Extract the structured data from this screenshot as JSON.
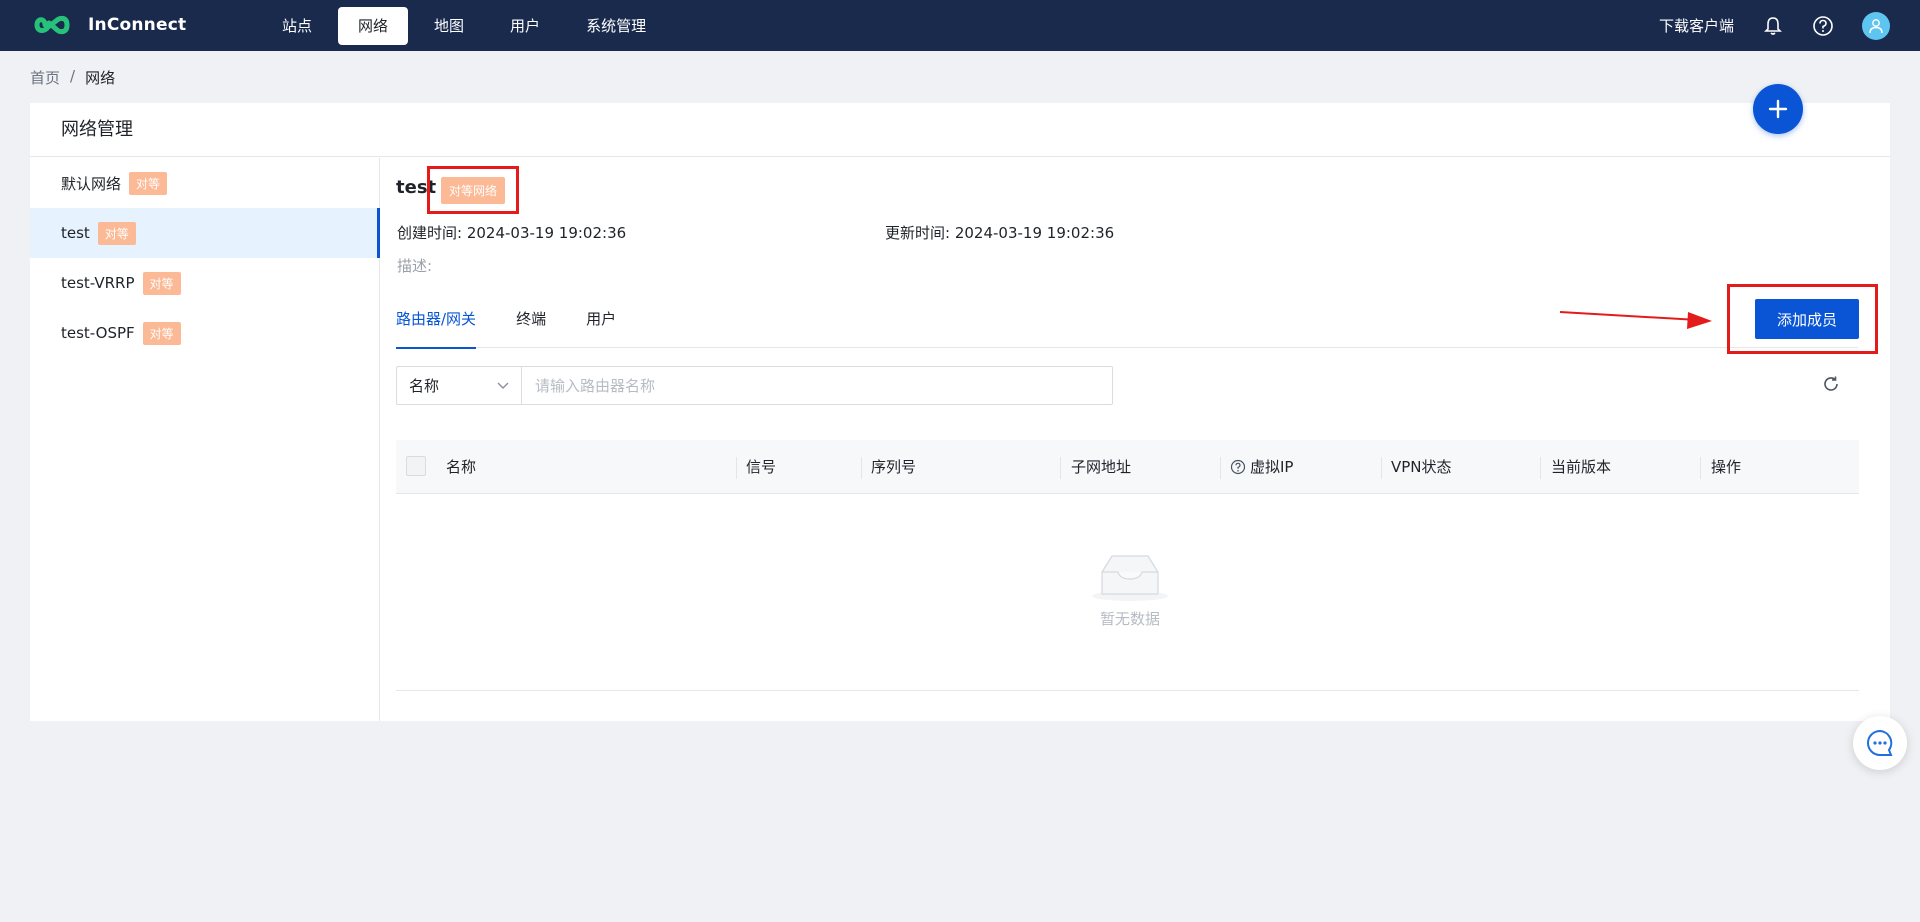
{
  "app": {
    "name": "InConnect"
  },
  "nav": {
    "items": [
      {
        "label": "站点",
        "active": false
      },
      {
        "label": "网络",
        "active": true
      },
      {
        "label": "地图",
        "active": false
      },
      {
        "label": "用户",
        "active": false
      },
      {
        "label": "系统管理",
        "active": false
      }
    ],
    "download": "下载客户端"
  },
  "breadcrumb": {
    "home": "首页",
    "separator": "/",
    "current": "网络"
  },
  "panel": {
    "title": "网络管理"
  },
  "sidebar": {
    "items": [
      {
        "name": "默认网络",
        "tag": "对等",
        "active": false
      },
      {
        "name": "test",
        "tag": "对等",
        "active": true
      },
      {
        "name": "test-VRRP",
        "tag": "对等",
        "active": false
      },
      {
        "name": "test-OSPF",
        "tag": "对等",
        "active": false
      }
    ]
  },
  "detail": {
    "name": "test",
    "type_tag": "对等网络",
    "created_label": "创建时间:",
    "created_value": "2024-03-19 19:02:36",
    "updated_label": "更新时间:",
    "updated_value": "2024-03-19 19:02:36",
    "desc_label": "描述:"
  },
  "tabs": [
    {
      "label": "路由器/网关",
      "active": true
    },
    {
      "label": "终端",
      "active": false
    },
    {
      "label": "用户",
      "active": false
    }
  ],
  "add_member": "添加成员",
  "filter": {
    "field": "名称",
    "placeholder": "请输入路由器名称"
  },
  "table": {
    "columns": [
      "名称",
      "信号",
      "序列号",
      "子网地址",
      "虚拟IP",
      "VPN状态",
      "当前版本",
      "操作"
    ],
    "empty_text": "暂无数据"
  },
  "colors": {
    "primary": "#0a55d6",
    "nav_bg": "#192a4d",
    "tag": "#fcb995",
    "highlight": "#e31b1b"
  }
}
